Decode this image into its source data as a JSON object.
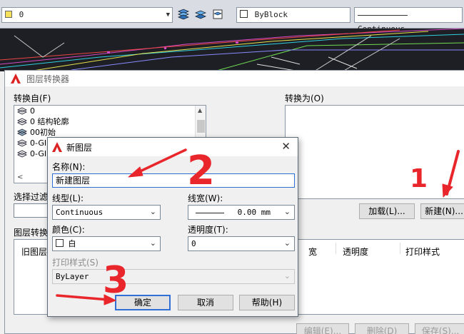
{
  "toolbar": {
    "layer_value": "0",
    "color_value": "ByBlock",
    "linetype_value": "Continuous"
  },
  "main_dialog": {
    "title": "图层转换器",
    "convert_from_label": "转换自(F)",
    "convert_to_label": "转换为(O)",
    "from_layers": [
      "0",
      "0 结构轮廓",
      "00初始",
      "0-GI",
      "0-GI"
    ],
    "select_filter_label": "选择过滤",
    "mappings_label": "图层转换",
    "load_button": "加载(L)...",
    "new_button": "新建(N)...",
    "columns": [
      "旧图层",
      "宽",
      "透明度",
      "打印样式"
    ],
    "edit_button": "编辑(E)...",
    "delete_button": "删除(D)",
    "save_button": "保存(S)..."
  },
  "new_layer_dialog": {
    "title": "新图层",
    "name_label": "名称(N):",
    "name_value": "新建图层",
    "linetype_label": "线型(L):",
    "linetype_value": "Continuous",
    "lineweight_label": "线宽(W):",
    "lineweight_value": "0.00 mm",
    "color_label": "颜色(C):",
    "color_value": "白",
    "transparency_label": "透明度(T):",
    "transparency_value": "0",
    "plotstyle_label": "打印样式(S)",
    "plotstyle_value": "ByLayer",
    "ok_button": "确定",
    "cancel_button": "取消",
    "help_button": "帮助(H)"
  },
  "annotations": {
    "one": "1",
    "two": "2",
    "three": "3"
  },
  "colors": {
    "annotation": "#e8262b",
    "cad_background": "#1d1f24",
    "accent": "#2f6fd6"
  }
}
